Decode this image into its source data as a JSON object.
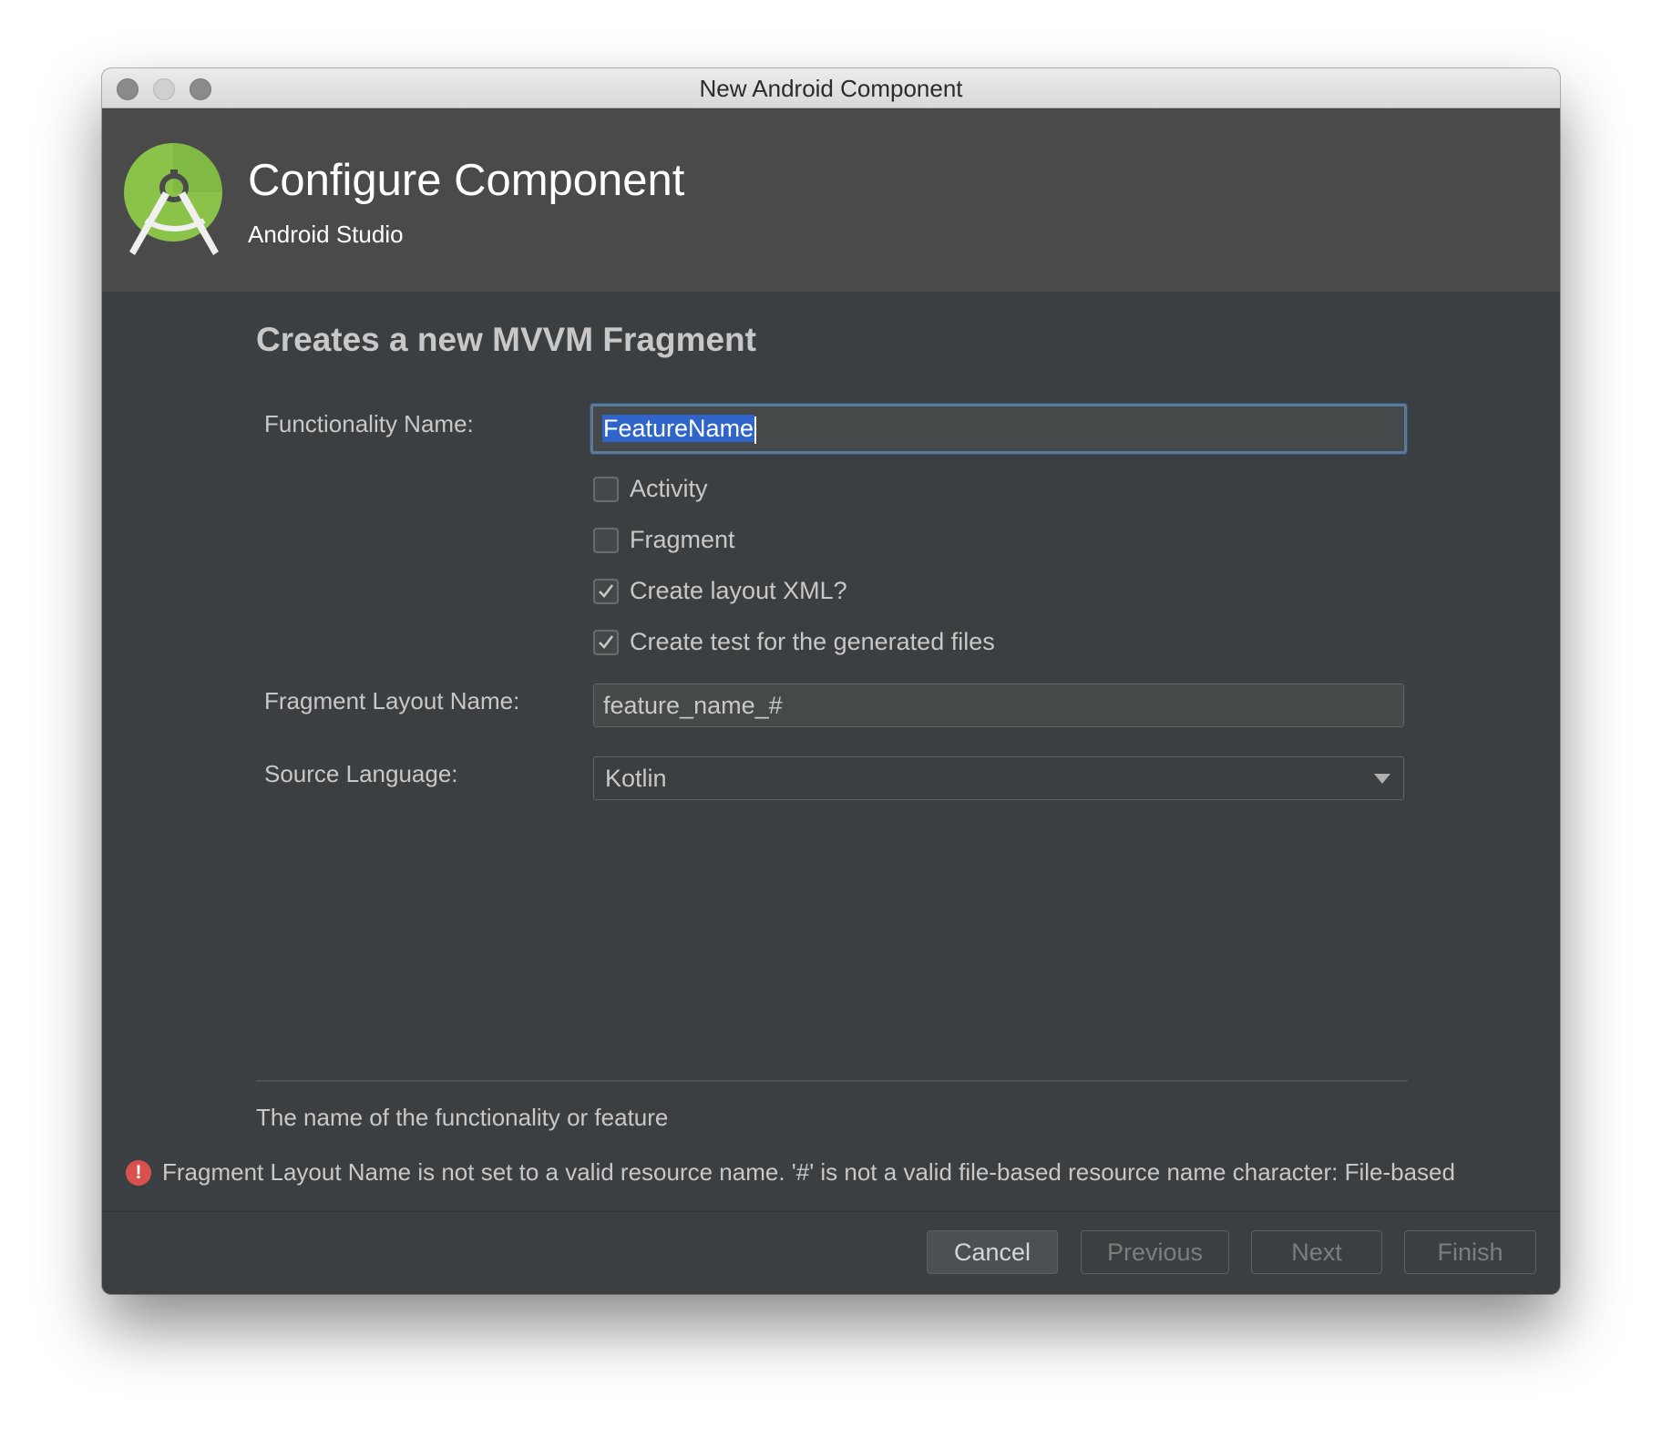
{
  "window": {
    "title": "New Android Component"
  },
  "banner": {
    "title": "Configure Component",
    "subtitle": "Android Studio",
    "logo_icon": "android-studio-logo-icon"
  },
  "form": {
    "heading": "Creates a new MVVM Fragment",
    "functionality_name": {
      "label": "Functionality Name:",
      "value": "FeatureName"
    },
    "checkboxes": [
      {
        "label": "Activity",
        "checked": false
      },
      {
        "label": "Fragment",
        "checked": false
      },
      {
        "label": "Create layout XML?",
        "checked": true
      },
      {
        "label": "Create test for the generated files",
        "checked": true
      }
    ],
    "fragment_layout_name": {
      "label": "Fragment Layout Name:",
      "value": "feature_name_#"
    },
    "source_language": {
      "label": "Source Language:",
      "value": "Kotlin"
    }
  },
  "help_text": "The name of the functionality or feature",
  "error": {
    "icon": "error-icon",
    "text": "Fragment Layout Name is not set to a valid resource name. '#' is not a valid file-based resource name character: File-based"
  },
  "buttons": {
    "cancel": "Cancel",
    "previous": "Previous",
    "next": "Next",
    "finish": "Finish"
  },
  "colors": {
    "dialog_bg": "#3c3f41",
    "banner_bg": "#4a4a4a",
    "selection": "#2f65ca",
    "error": "#d9514e",
    "logo_green": "#8bc34a"
  }
}
